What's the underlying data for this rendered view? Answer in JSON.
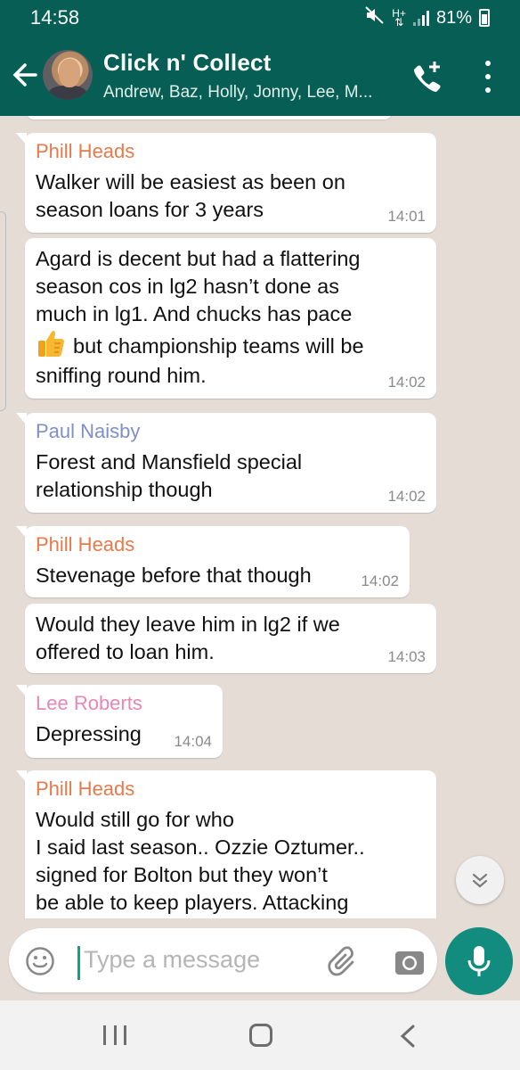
{
  "status_bar": {
    "time": "14:58",
    "battery": "81%"
  },
  "header": {
    "title": "Click n' Collect",
    "subtitle": "Andrew, Baz, Holly, Jonny, Lee, M..."
  },
  "colors": {
    "header_bg": "#075e54",
    "chat_bg": "#e5ddd5",
    "accent": "#128c7e",
    "sender_phill": "#e8794a",
    "sender_paul": "#7f8fc8",
    "sender_lee": "#e886b5"
  },
  "messages": [
    {
      "sender": "Phill Heads",
      "lines": [
        "Walker will be easiest as been on",
        "season loans for 3 years"
      ],
      "time": "14:01"
    },
    {
      "lines": [
        "Agard is decent but had a flattering",
        "season cos in lg2  hasn’t done as",
        "much in lg1. And chucks has pace"
      ],
      "line_after_emoji": "but championship teams will be",
      "emoji": "thumbs-up",
      "last_line": "sniffing round him.",
      "time": "14:02"
    },
    {
      "sender": "Paul Naisby",
      "lines": [
        "Forest and Mansfield special",
        "relationship though"
      ],
      "time": "14:02"
    },
    {
      "sender": "Phill Heads",
      "lines": [
        "Stevenage before that though"
      ],
      "time": "14:02"
    },
    {
      "lines": [
        "Would they leave him in lg2 if we",
        "offered to loan him."
      ],
      "time": "14:03"
    },
    {
      "sender": "Lee Roberts",
      "lines": [
        "Depressing"
      ],
      "time": "14:04"
    },
    {
      "sender": "Phill Heads",
      "lines": [
        "Would still go for who",
        "I said last season.. Ozzie Oztumer..",
        "signed for Bolton but they won’t",
        "be able to keep players. Attacking"
      ]
    }
  ],
  "input": {
    "placeholder": "Type a message"
  },
  "icons": [
    "back-arrow-icon",
    "add-call-icon",
    "overflow-menu-icon",
    "emoji-icon",
    "attach-icon",
    "camera-icon",
    "mic-icon",
    "scroll-down-icon"
  ]
}
